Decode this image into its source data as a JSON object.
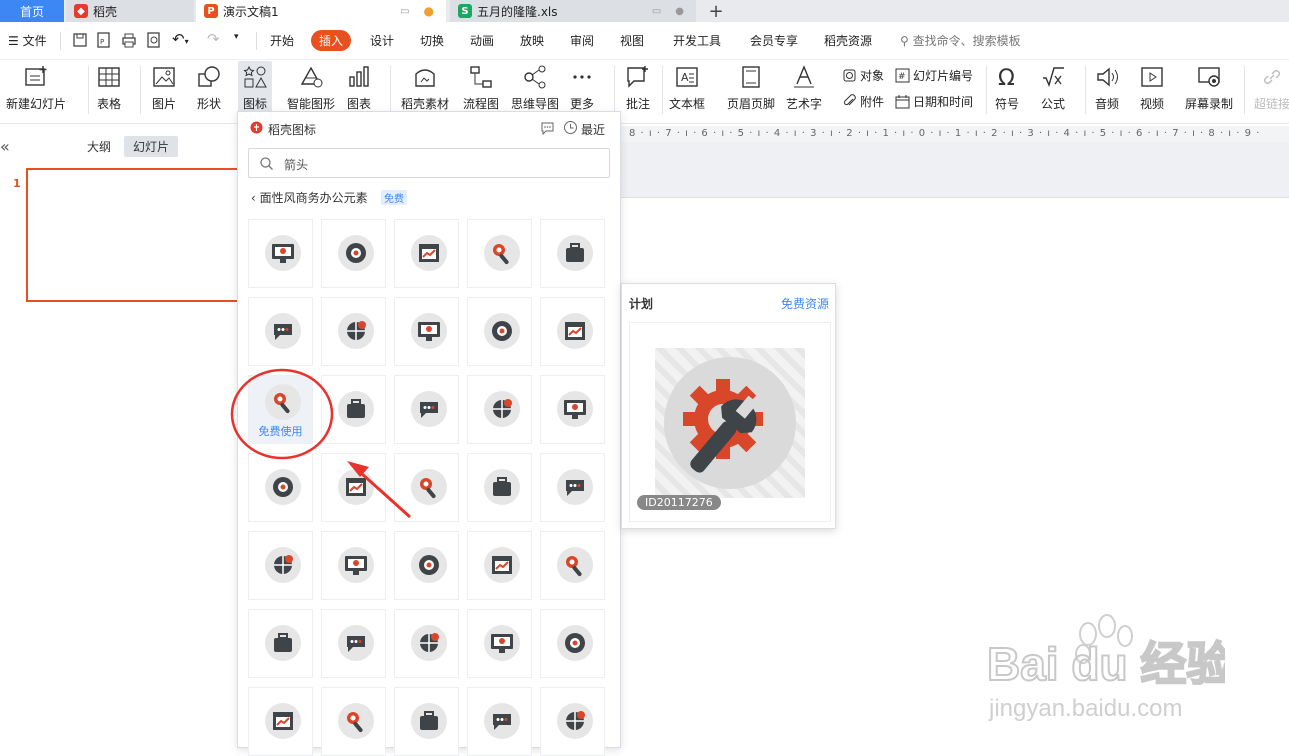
{
  "tabs": {
    "home": "首页",
    "daoke": "稻壳",
    "ppt": "演示文稿1",
    "xls": "五月的隆隆.xls",
    "add": "+"
  },
  "menu": {
    "file": "文件",
    "items": [
      "开始",
      "插入",
      "设计",
      "切换",
      "动画",
      "放映",
      "审阅",
      "视图",
      "开发工具",
      "会员专享",
      "稻壳资源"
    ],
    "search_placeholder": "查找命令、搜索模板"
  },
  "ribbon": {
    "new_slide": "新建幻灯片",
    "table": "表格",
    "picture": "图片",
    "shape": "形状",
    "icons": "图标",
    "smart_graphic": "智能图形",
    "chart": "图表",
    "daoke_material": "稻壳素材",
    "flowchart": "流程图",
    "mindmap": "思维导图",
    "more": "更多",
    "comment": "批注",
    "textbox": "文本框",
    "header_footer": "页眉页脚",
    "wordart": "艺术字",
    "object": "对象",
    "attachment": "附件",
    "slide_number": "幻灯片编号",
    "date_time": "日期和时间",
    "symbol": "符号",
    "formula": "公式",
    "audio": "音频",
    "video": "视频",
    "screen_record": "屏幕录制",
    "hyperlink": "超链接"
  },
  "left_pane": {
    "collapse": "«",
    "outline_tab": "大纲",
    "slides_tab": "幻灯片",
    "slide_number": "1"
  },
  "ruler_text": "8 · ı · 7 · ı · 6 · ı · 5 · ı · 4 · ı · 3 · ı · 2 · ı · 1 · ı · 0 · ı · 1 · ı · 2 · ı · 3 · ı · 4 · ı · 5 · ı · 6 · ı · 7 · ı · 8 · ı · 9 ·",
  "icon_panel": {
    "title": "稻壳图标",
    "recent": "最近",
    "search_value": "箭头",
    "breadcrumb": "面性风商务办公元素",
    "free_badge": "免费",
    "free_use_label": "免费使用",
    "icons": [
      "money-monitor-icon",
      "chat-person-icon",
      "chart-monitor-icon",
      "data-window-icon",
      "devices-icon",
      "window-settings-icon",
      "person-cycle-icon",
      "target-icon",
      "window-edit-icon",
      "window-chart-icon",
      "wrench-gear-icon",
      "document-pen-icon",
      "window-download-icon",
      "person-shovel-icon",
      "chain-plus-icon",
      "code-window-icon",
      "brain-shield-icon",
      "seo-tag-icon",
      "window-trend-icon",
      "phone-gear-icon",
      "donut-chart-icon",
      "person-gear-icon",
      "cloud-laptop-icon",
      "globe-network-icon",
      "magnify-key-icon",
      "briefcase-icon",
      "lightbulb-icon",
      "thumbs-up-icon",
      "shopping-cart-icon",
      "window-box-icon",
      "globe-pin-icon",
      "speech-bubble-icon",
      "window-wrench-icon",
      "window-search-icon",
      "gears-icon"
    ]
  },
  "preview": {
    "title": "计划",
    "free_resource": "免费资源",
    "id": "ID20117276"
  },
  "watermark": {
    "brand": "Bai du 经验",
    "url": "jingyan.baidu.com"
  },
  "colors": {
    "accent": "#e9501f",
    "blue": "#3d87f5",
    "annotation_red": "#e8332d",
    "icon_dark": "#3f4448",
    "icon_orange": "#d9472b"
  }
}
